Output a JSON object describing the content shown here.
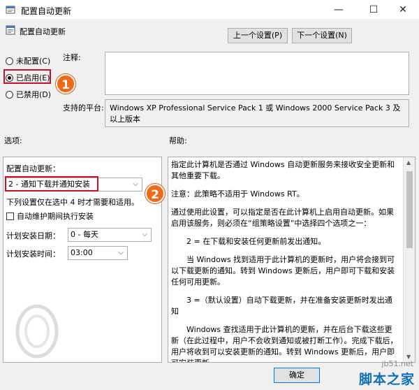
{
  "window": {
    "title": "配置自动更新",
    "minimize": "—",
    "maximize": "☐",
    "close": "✕"
  },
  "header": {
    "policy_name": "配置自动更新",
    "prev_button": "上一个设置(P)",
    "next_button": "下一个设置(N)"
  },
  "state": {
    "options": [
      {
        "label": "未配置(C)",
        "checked": false
      },
      {
        "label": "已启用(E)",
        "checked": true
      },
      {
        "label": "已禁用(D)",
        "checked": false
      }
    ]
  },
  "comment": {
    "label": "注释:",
    "value": ""
  },
  "platform": {
    "label": "支持的平台:",
    "value": "Windows XP Professional Service Pack 1 或 Windows 2000 Service Pack 3 及以上版本"
  },
  "sections": {
    "options_label": "选项:",
    "help_label": "帮助:"
  },
  "options_panel": {
    "configure_label": "配置自动更新：",
    "configure_value": "2 - 通知下载并通知安装",
    "note": "下列设置仅在选中 4 时才需要和适用。",
    "maintenance_checkbox": "自动维护期间执行安装",
    "maintenance_checked": false,
    "schedule_day_label": "计划安装日期：",
    "schedule_day_value": "0 - 每天",
    "schedule_time_label": "计划安装时间：",
    "schedule_time_value": "03:00"
  },
  "help": {
    "paragraphs": [
      "指定此计算机是否通过 Windows 自动更新服务来接收安全更新和其他重要下载。",
      "注意：此策略不适用于 Windows RT。",
      "通过使用此设置，可以指定是否在此计算机上启用自动更新。如果启用该服务，则必须在“组策略设置”中选择四个选项之一：",
      "2 = 在下载和安装任何更新前发出通知。",
      "当 Windows 找到适用于此计算机的更新时，用户将会接到可以下载更新的通知。转到 Windows 更新后，用户即可下载和安装任何可用更新。",
      "3 =（默认设置）自动下载更新，并在准备安装更新时发出通知",
      "Windows 查找适用于此计算机的更新，并在后台下载这些更新（在此过程中，用户不会收到通知或被打断工作）。完成下载后，用户将收到可以安装更新的通知。转到 Windows 更新后，用户即可安装更新。"
    ]
  },
  "footer": {
    "ok_button": "确定"
  },
  "annotations": {
    "callout_1": "1",
    "callout_2": "2"
  },
  "watermark": {
    "domain": "jb51.net",
    "brand": "脚本之家"
  }
}
